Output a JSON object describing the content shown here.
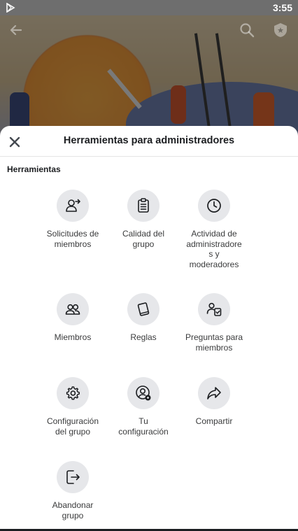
{
  "status_bar": {
    "time": "3:55",
    "app_icon": "play-store-icon"
  },
  "cover": {
    "back_icon": "arrow-left-icon",
    "search_icon": "search-icon",
    "shield_icon": "admin-shield-icon"
  },
  "sheet": {
    "close_icon": "close-icon",
    "title": "Herramientas para administradores",
    "section_title": "Herramientas",
    "tools": [
      {
        "label": "Solicitudes de\nmiembros",
        "icon": "member-request-icon"
      },
      {
        "label": "Calidad del\ngrupo",
        "icon": "clipboard-icon"
      },
      {
        "label": "Actividad de\nadministradore\ns y\nmoderadores",
        "icon": "clock-icon"
      },
      {
        "label": "Miembros",
        "icon": "members-icon"
      },
      {
        "label": "Reglas",
        "icon": "rules-book-icon"
      },
      {
        "label": "Preguntas para\nmiembros",
        "icon": "member-questions-icon"
      },
      {
        "label": "Configuración\ndel grupo",
        "icon": "gear-icon"
      },
      {
        "label": "Tu\nconfiguración",
        "icon": "user-settings-icon"
      },
      {
        "label": "Compartir",
        "icon": "share-arrow-icon"
      },
      {
        "label": "Abandonar\ngrupo",
        "icon": "exit-icon"
      }
    ]
  },
  "colors": {
    "icon_bg": "#e6e7ea",
    "text_primary": "#1c1e21",
    "text_secondary": "#3a3b3c"
  }
}
